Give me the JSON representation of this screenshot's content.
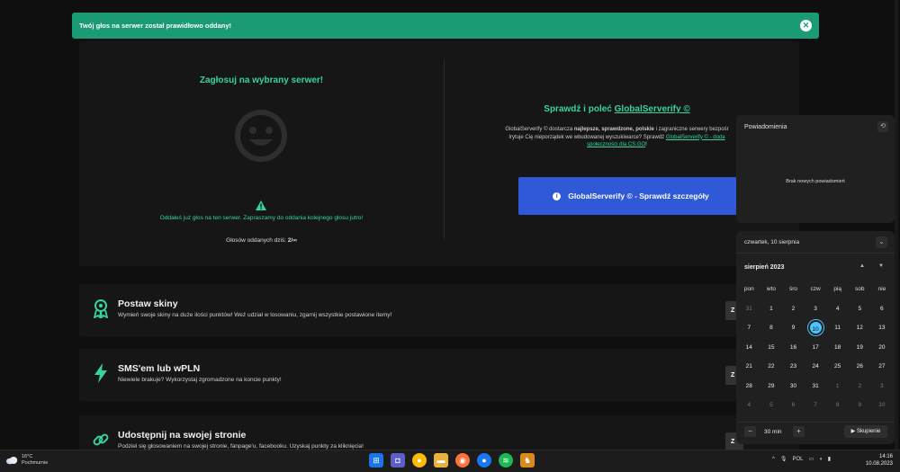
{
  "alert": {
    "message": "Twój głos na serwer został prawidłowo oddany!"
  },
  "vote": {
    "title": "Zagłosuj na wybrany serwer!",
    "message": "Oddałeś już głos na ten serwer. Zapraszamy do oddania kolejnego głosu jutro!",
    "count_label": "Głosów oddanych dziś:",
    "count_value": "2/∞"
  },
  "promo": {
    "title_prefix": "Sprawdź i poleć",
    "title_link": "GlobalServerify ©",
    "line1_a": "GlobalServerify © dostarcza",
    "line1_b": "najlepsze, sprawdzone, polskie",
    "line1_c": "i zagraniczne serwery bezpośr",
    "line2_a": "Irytuje Cię nieporządek we wbudowanej wyszukiwarce? Sprawdź",
    "line2_link": "GlobalServerify © - doda",
    "line3_link": "społeczności dla CS:GO",
    "line3_end": "!",
    "button_label": "GlobalServerify © - Sprawdź szczegóły"
  },
  "features": [
    {
      "title": "Postaw skiny",
      "desc": "Wymień swoje skiny na duże ilości punktów! Weź udział w losowaniu, zgarnij wszystkie postawione itemy!",
      "button": "Z"
    },
    {
      "title": "SMS'em lub wPLN",
      "desc": "Niewiele brakuje? Wykorzystaj zgromadzone na koncie punkty!",
      "button": "Z"
    },
    {
      "title": "Udostępnij na swojej stronie",
      "desc": "Podziel się głosowaniem na swojej stronie, fanpage'u, facebooku. Uzyskaj punkty za kliknięcia!",
      "button": "Z"
    }
  ],
  "notifications": {
    "title": "Powiadomienia",
    "empty": "Brak nowych powiadomień"
  },
  "calendar": {
    "date_label": "czwartek, 10 sierpnia",
    "month": "sierpień 2023",
    "weekdays": [
      "pon",
      "wto",
      "śro",
      "czw",
      "pią",
      "sob",
      "nie"
    ],
    "days": [
      {
        "d": "31",
        "m": "prev"
      },
      {
        "d": "1"
      },
      {
        "d": "2"
      },
      {
        "d": "3"
      },
      {
        "d": "4"
      },
      {
        "d": "5"
      },
      {
        "d": "6"
      },
      {
        "d": "7"
      },
      {
        "d": "8"
      },
      {
        "d": "9"
      },
      {
        "d": "10",
        "today": true
      },
      {
        "d": "11"
      },
      {
        "d": "12"
      },
      {
        "d": "13"
      },
      {
        "d": "14"
      },
      {
        "d": "15"
      },
      {
        "d": "16"
      },
      {
        "d": "17"
      },
      {
        "d": "18"
      },
      {
        "d": "19"
      },
      {
        "d": "20"
      },
      {
        "d": "21"
      },
      {
        "d": "22"
      },
      {
        "d": "23"
      },
      {
        "d": "24"
      },
      {
        "d": "25"
      },
      {
        "d": "26"
      },
      {
        "d": "27"
      },
      {
        "d": "28"
      },
      {
        "d": "29"
      },
      {
        "d": "30"
      },
      {
        "d": "31"
      },
      {
        "d": "1",
        "m": "next"
      },
      {
        "d": "2",
        "m": "next"
      },
      {
        "d": "3",
        "m": "next"
      },
      {
        "d": "4",
        "m": "next"
      },
      {
        "d": "5",
        "m": "next"
      },
      {
        "d": "6",
        "m": "next"
      },
      {
        "d": "7",
        "m": "next"
      },
      {
        "d": "8",
        "m": "next"
      },
      {
        "d": "9",
        "m": "next"
      },
      {
        "d": "10",
        "m": "next"
      }
    ],
    "focus_minutes": "30 min",
    "focus_button": "Skupienie"
  },
  "taskbar": {
    "temp": "16°C",
    "weather": "Pochmurnie",
    "lang": "POL",
    "time": "14:16",
    "date": "10.08.2023"
  },
  "colors": {
    "accent": "#37d49a",
    "alert_bg": "#1a9b73",
    "promo_btn": "#2f59d6",
    "today": "#4cc2ff"
  }
}
